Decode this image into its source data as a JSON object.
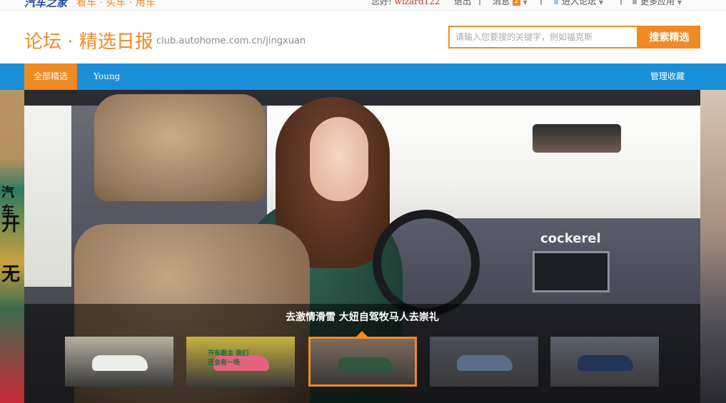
{
  "topbar": {
    "logo": "汽车之家",
    "nav": "看车 · 买车 · 用车",
    "greeting": "您好!",
    "username": "wizard122",
    "logout": "退出",
    "messages": "消息",
    "message_count": "2",
    "enter_forum": "进入论坛",
    "more_apps": "更多应用"
  },
  "header": {
    "title": "论坛 · 精选日报",
    "url": "club.autohome.com.cn/jingxuan",
    "search_placeholder": "请输入您要搜的关键字，例如福克斯",
    "search_button": "搜索精选"
  },
  "nav": {
    "items": [
      {
        "label": "全部精选"
      },
      {
        "label": "Young"
      }
    ],
    "manage": "管理收藏"
  },
  "hero": {
    "caption": "去激情滑雪 大妞自驾牧马人去崇礼",
    "dash_brand": "cockerel",
    "side_banner": [
      "汽车",
      "开",
      "无"
    ],
    "thumbs": [
      {
        "name": "white-sedan",
        "bg": "#b7b0a3",
        "car": "#ededea",
        "active": false
      },
      {
        "name": "forum-promo",
        "bg": "#c9b341",
        "car": "#e6637f",
        "text": "开车跟主 我们还会有一场",
        "active": false
      },
      {
        "name": "jeep-interior",
        "bg": "#7c6b5e",
        "car": "#33553f",
        "active": true
      },
      {
        "name": "blue-suv",
        "bg": "#4a4f5a",
        "car": "#5b6e86",
        "active": false
      },
      {
        "name": "dark-sedan",
        "bg": "#5a5f6a",
        "car": "#243455",
        "active": false
      }
    ]
  },
  "colors": {
    "accent": "#f08a24",
    "nav_bar": "#1a8fd8",
    "logo_blue": "#1f4f9e"
  }
}
